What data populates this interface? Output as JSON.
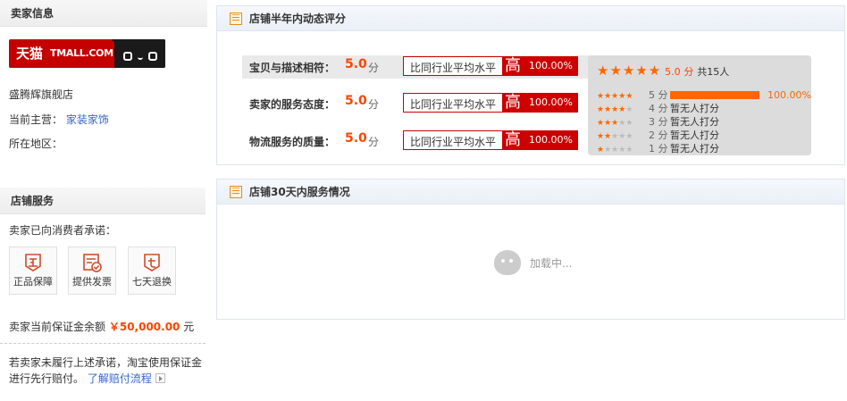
{
  "seller": {
    "section_title": "卖家信息",
    "logo_cn": "天猫",
    "logo_en": "TMALL.COM",
    "shop_name": "盛腾辉旗舰店",
    "main_business_label": "当前主营：",
    "main_business_value": "家装家饰",
    "region_label": "所在地区："
  },
  "services": {
    "section_title": "店铺服务",
    "promise_text": "卖家已向消费者承诺：",
    "items": [
      {
        "label": "正品保障",
        "icon": "genuine-icon"
      },
      {
        "label": "提供发票",
        "icon": "invoice-icon"
      },
      {
        "label": "七天退换",
        "icon": "seven-day-return-icon"
      }
    ],
    "deposit_label": "卖家当前保证金余额",
    "deposit_amount": "￥50,000.00",
    "deposit_unit": "元",
    "notice_line1": "若卖家未履行上述承诺，淘宝使用保证金",
    "notice_line2": "进行先行赔付。",
    "notice_link": "了解赔付流程"
  },
  "rating": {
    "title": "店铺半年内动态评分",
    "rows": [
      {
        "label": "宝贝与描述相符：",
        "score": "5.0",
        "unit": "分",
        "compare": "比同行业平均水平",
        "level": "高",
        "percent": "100.00%"
      },
      {
        "label": "卖家的服务态度：",
        "score": "5.0",
        "unit": "分",
        "compare": "比同行业平均水平",
        "level": "高",
        "percent": "100.00%"
      },
      {
        "label": "物流服务的质量：",
        "score": "5.0",
        "unit": "分",
        "compare": "比同行业平均水平",
        "level": "高",
        "percent": "100.00%"
      }
    ],
    "summary_score": "5.0",
    "summary_unit": "分",
    "summary_total": "共15人",
    "distribution": [
      {
        "stars": 5,
        "label": "5 分",
        "value": "100.00%",
        "fraction": 1.0
      },
      {
        "stars": 4,
        "label": "4 分",
        "value": "暂无人打分",
        "fraction": 0
      },
      {
        "stars": 3,
        "label": "3 分",
        "value": "暂无人打分",
        "fraction": 0
      },
      {
        "stars": 2,
        "label": "2 分",
        "value": "暂无人打分",
        "fraction": 0
      },
      {
        "stars": 1,
        "label": "1 分",
        "value": "暂无人打分",
        "fraction": 0
      }
    ]
  },
  "service30": {
    "title": "店铺30天内服务情况",
    "loading_text": "加载中..."
  },
  "colors": {
    "accent": "#ff6600",
    "brand_red": "#cc0000",
    "link": "#3366cc"
  }
}
